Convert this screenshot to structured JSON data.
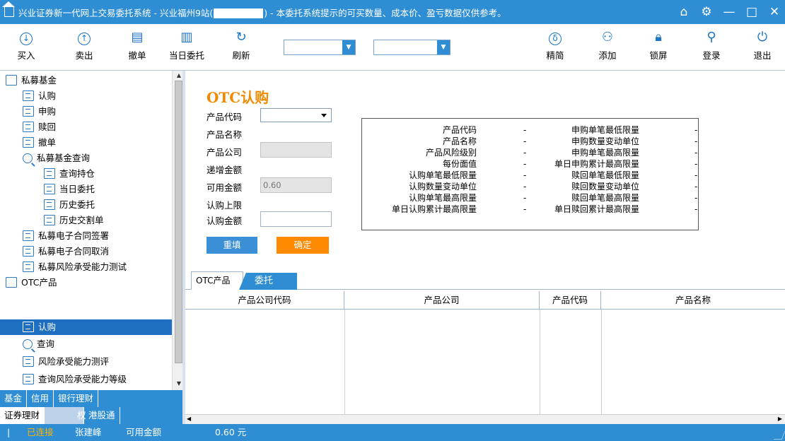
{
  "window": {
    "title_prefix": "兴业证券新一代网上交易委托系统 - 兴业福州9站(",
    "title_suffix": ") - 本委托系统提示的可买数量、成本价、盈亏数据仅供参考。",
    "controls": [
      "⌂",
      "⚙",
      "—",
      "□",
      "✕"
    ]
  },
  "toolbar": {
    "buy": "买入",
    "sell": "卖出",
    "cancel": "撤单",
    "today_entrust": "当日委托",
    "refresh": "刷新",
    "simple": "精简",
    "add": "添加",
    "lock": "锁屏",
    "login": "登录",
    "exit": "退出"
  },
  "tree": {
    "items": [
      {
        "label": "私募基金",
        "level": 0
      },
      {
        "label": "认购",
        "level": 1
      },
      {
        "label": "申购",
        "level": 1
      },
      {
        "label": "赎回",
        "level": 1
      },
      {
        "label": "撤单",
        "level": 1
      },
      {
        "label": "私募基金查询",
        "level": 1
      },
      {
        "label": "查询持仓",
        "level": 2
      },
      {
        "label": "当日委托",
        "level": 2
      },
      {
        "label": "历史委托",
        "level": 2
      },
      {
        "label": "历史交割单",
        "level": 2
      },
      {
        "label": "私募电子合同签署",
        "level": 1
      },
      {
        "label": "私募电子合同取消",
        "level": 1
      },
      {
        "label": "私募风险承受能力测试",
        "level": 1
      },
      {
        "label": "OTC产品",
        "level": 0
      },
      {
        "label": "认购",
        "level": 1,
        "selected": true
      },
      {
        "label": "查询",
        "level": 1
      },
      {
        "label": "风险承受能力测评",
        "level": 1
      },
      {
        "label": "查询风险承受能力等级",
        "level": 1
      }
    ]
  },
  "bottom_tabs_row1": [
    "基金",
    "信用",
    "银行理财"
  ],
  "bottom_tabs_row2": [
    "证券理财",
    "权",
    "港股通"
  ],
  "form": {
    "title": "OTC认购",
    "product_code_label": "产品代码",
    "product_name_label": "产品名称",
    "product_company_label": "产品公司",
    "increment_label": "递增金额",
    "available_label": "可用金额",
    "available_value": "0.60",
    "limit_label": "认购上限",
    "amount_label": "认购金额",
    "reset_button": "重填",
    "confirm_button": "确定"
  },
  "info": {
    "left": [
      "产品代码",
      "产品名称",
      "产品风险级别",
      "每份面值",
      "认购单笔最低限量",
      "认购数量变动单位",
      "认购单笔最高限量",
      "单日认购累计最高限量"
    ],
    "right": [
      "申购单笔最低限量",
      "申购数量变动单位",
      "申购单笔最高限量",
      "单日申购累计最高限量",
      "赎回单笔最低限量",
      "赎回数量变动单位",
      "赎回单笔最高限量",
      "单日赎回累计最高限量"
    ],
    "dash": "-"
  },
  "result_tabs": {
    "otc_product": "OTC产品",
    "entrust": "委托"
  },
  "table": {
    "columns": [
      "产品公司代码",
      "产品公司",
      "产品代码",
      "产品名称"
    ]
  },
  "status": {
    "connected": "已连接",
    "user": "张建峰",
    "available_label": "可用金额",
    "available_value": "0.60 元"
  }
}
